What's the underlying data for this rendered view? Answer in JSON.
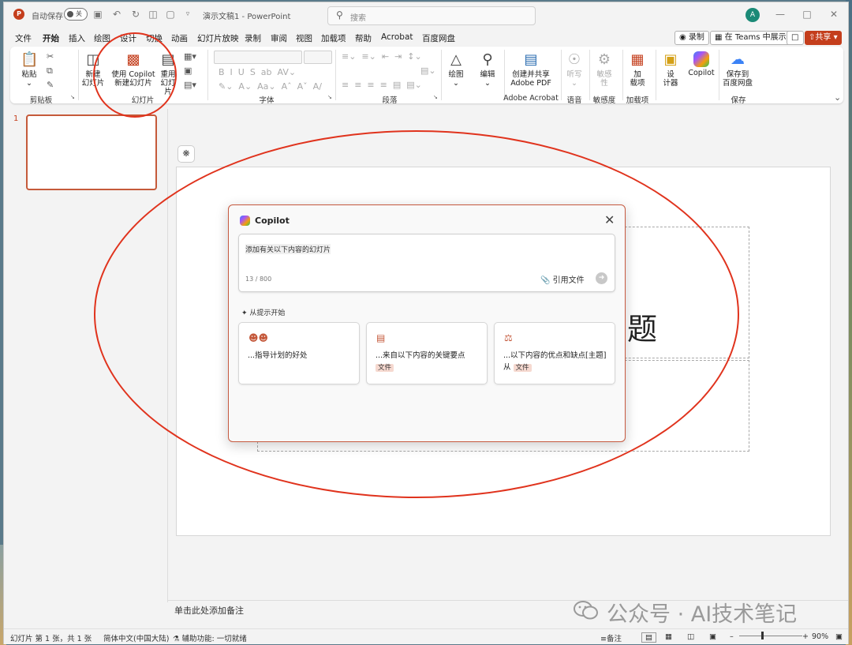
{
  "titlebar": {
    "autosave_label": "自动保存",
    "autosave_state": "关",
    "title": "演示文稿1 - PowerPoint",
    "search_placeholder": "搜索",
    "avatar_initial": "A"
  },
  "menu": {
    "tabs": [
      "文件",
      "开始",
      "插入",
      "绘图",
      "设计",
      "切换",
      "动画",
      "幻灯片放映",
      "录制",
      "审阅",
      "视图",
      "加载项",
      "帮助",
      "Acrobat",
      "百度网盘"
    ],
    "active_tab": "开始",
    "record_btn": "录制",
    "teams_btn": "在 Teams 中展示",
    "share_btn": "共享"
  },
  "ribbon": {
    "paste": "粘贴",
    "clipboard_group": "剪贴板",
    "new_slide_1": "新建",
    "new_slide_2": "幻灯片",
    "copilot_new_1": "使用 Copilot",
    "copilot_new_2": "新建幻灯片",
    "reuse_1": "重用",
    "reuse_2": "幻灯片",
    "slides_group": "幻灯片",
    "font_group": "字体",
    "paragraph_group": "段落",
    "draw": "绘图",
    "edit": "编辑",
    "create_pdf_1": "创建并共享",
    "create_pdf_2": "Adobe PDF",
    "acrobat_group": "Adobe Acrobat",
    "dictate": "听写",
    "voice_group": "语音",
    "sensitivity_1": "敏感",
    "sensitivity_2": "性",
    "sensitivity_group": "敏感度",
    "addins_1": "加",
    "addins_2": "载项",
    "addins_group": "加载项",
    "designer_1": "设",
    "designer_2": "计器",
    "copilot": "Copilot",
    "save_baidu_1": "保存到",
    "save_baidu_2": "百度网盘",
    "save_group": "保存"
  },
  "slide_panel": {
    "thumb_number": "1"
  },
  "slide": {
    "title_fragment": "题"
  },
  "copilot_dialog": {
    "title": "Copilot",
    "prompt_text": "添加有关以下内容的幻灯片",
    "char_count": "13 / 800",
    "attach_label": "引用文件",
    "start_label": "从提示开始",
    "cards": [
      {
        "line1": "...指导计划的好处",
        "tag": ""
      },
      {
        "line1": "...来自以下内容的关键要点",
        "tag": "文件"
      },
      {
        "line1": "...以下内容的优点和缺点[主题]",
        "prefix": "从",
        "tag": "文件"
      }
    ]
  },
  "notes": {
    "placeholder": "单击此处添加备注"
  },
  "statusbar": {
    "slide_info": "幻灯片 第 1 张，共 1 张",
    "language": "简体中文(中国大陆)",
    "accessibility": "辅助功能: 一切就绪",
    "notes_btn": "备注",
    "zoom": "90%"
  },
  "watermark": {
    "text": "公众号 · AI技术笔记"
  },
  "colors": {
    "accent": "#c43e1c",
    "annotation": "#e0331d"
  }
}
